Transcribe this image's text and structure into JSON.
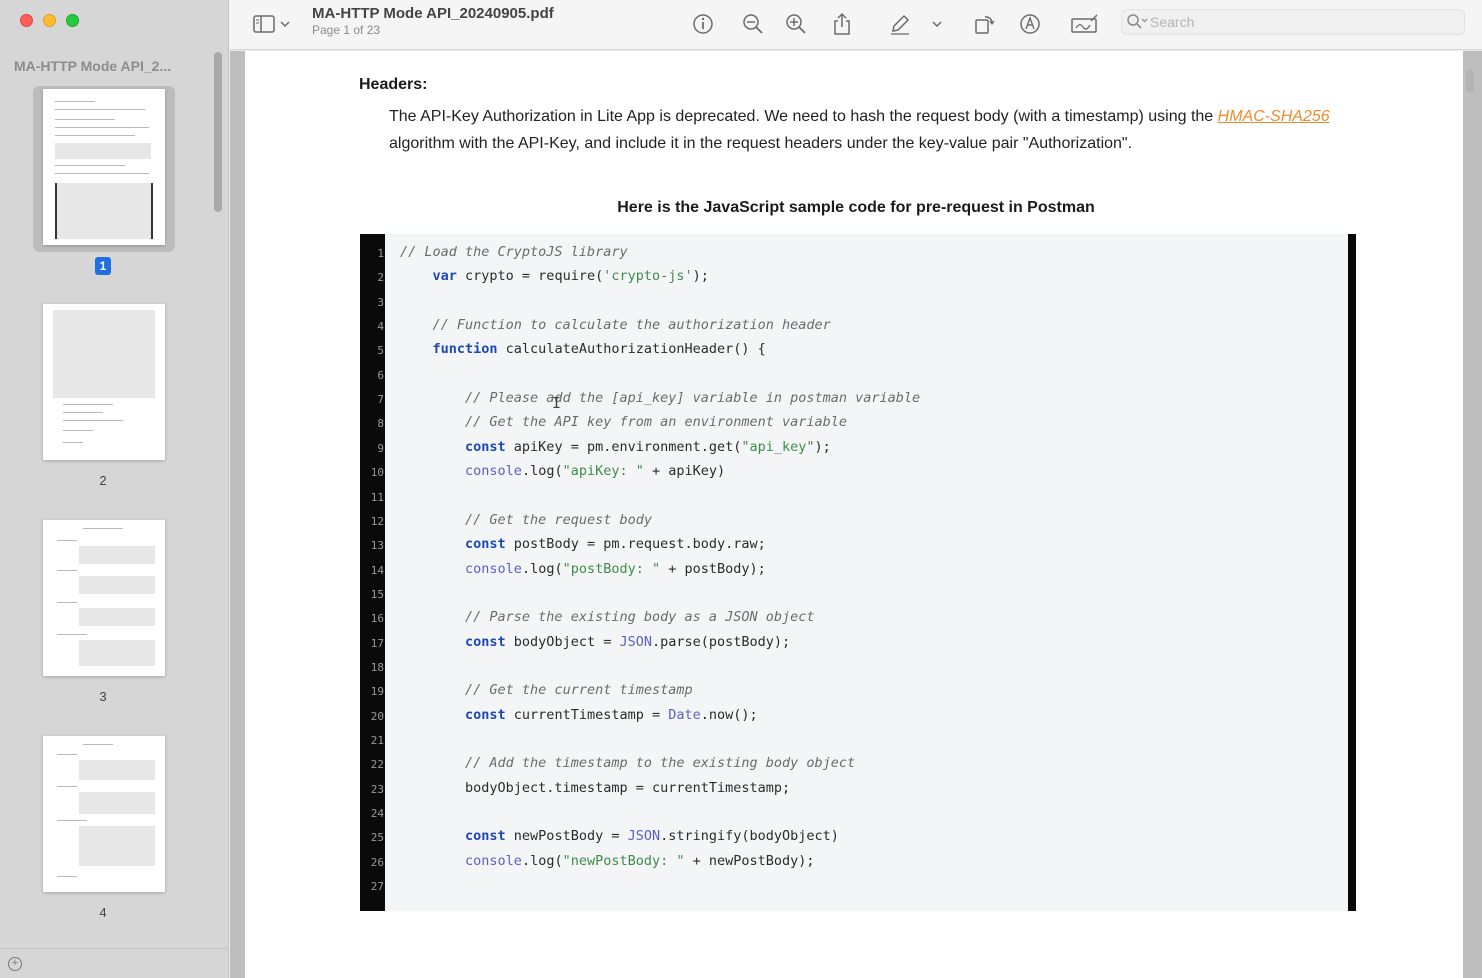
{
  "window": {
    "title": "MA-HTTP Mode API_20240905.pdf",
    "subtitle": "Page 1 of 23"
  },
  "sidebar": {
    "title": "MA-HTTP Mode API_2...",
    "pages": [
      {
        "label": "1",
        "selected": true
      },
      {
        "label": "2",
        "selected": false
      },
      {
        "label": "3",
        "selected": false
      },
      {
        "label": "4",
        "selected": false
      }
    ]
  },
  "toolbar": {
    "icons": [
      "sidebar-toggle-icon",
      "chevron-down-icon",
      "info-icon",
      "zoom-out-icon",
      "zoom-in-icon",
      "share-icon",
      "markup-pen-icon",
      "chevron-down-icon",
      "rotate-icon",
      "annotate-icon",
      "signature-icon",
      "search-icon"
    ],
    "search_placeholder": "Search"
  },
  "document": {
    "heading": "Headers:",
    "para_before_link": "The API-Key Authorization in Lite App is deprecated. We need to hash the request body (with a timestamp) using the ",
    "link_text": "HMAC-SHA256",
    "para_after_link": " algorithm with the API-Key, and include it in the request headers under the key-value pair \"Authorization\".",
    "code_caption": "Here is the JavaScript sample code for pre-request in Postman",
    "link_color": "#f08a2c",
    "code_lines": [
      [
        {
          "t": "// Load the CryptoJS library",
          "c": "cm"
        }
      ],
      [
        {
          "t": "    "
        },
        {
          "t": "var",
          "c": "kw"
        },
        {
          "t": " crypto = require("
        },
        {
          "t": "'crypto-js'",
          "c": "st"
        },
        {
          "t": ");"
        }
      ],
      [],
      [
        {
          "t": "    "
        },
        {
          "t": "// Function to calculate the authorization header",
          "c": "cm"
        }
      ],
      [
        {
          "t": "    "
        },
        {
          "t": "function",
          "c": "kw"
        },
        {
          "t": " calculateAuthorizationHeader() {"
        }
      ],
      [],
      [
        {
          "t": "        "
        },
        {
          "t": "// Please add the [api_key] variable in postman variable",
          "c": "cm"
        }
      ],
      [
        {
          "t": "        "
        },
        {
          "t": "// Get the API key from an environment variable",
          "c": "cm"
        }
      ],
      [
        {
          "t": "        "
        },
        {
          "t": "const",
          "c": "kw"
        },
        {
          "t": " apiKey = pm.environment.get("
        },
        {
          "t": "\"api_key\"",
          "c": "st"
        },
        {
          "t": ");"
        }
      ],
      [
        {
          "t": "        "
        },
        {
          "t": "console",
          "c": "bi"
        },
        {
          "t": ".log("
        },
        {
          "t": "\"apiKey: \"",
          "c": "st"
        },
        {
          "t": " + apiKey)"
        }
      ],
      [],
      [
        {
          "t": "        "
        },
        {
          "t": "// Get the request body",
          "c": "cm"
        }
      ],
      [
        {
          "t": "        "
        },
        {
          "t": "const",
          "c": "kw"
        },
        {
          "t": " postBody = pm.request.body.raw;"
        }
      ],
      [
        {
          "t": "        "
        },
        {
          "t": "console",
          "c": "bi"
        },
        {
          "t": ".log("
        },
        {
          "t": "\"postBody: \"",
          "c": "st"
        },
        {
          "t": " + postBody);"
        }
      ],
      [],
      [
        {
          "t": "        "
        },
        {
          "t": "// Parse the existing body as a JSON object",
          "c": "cm"
        }
      ],
      [
        {
          "t": "        "
        },
        {
          "t": "const",
          "c": "kw"
        },
        {
          "t": " bodyObject = "
        },
        {
          "t": "JSON",
          "c": "bi"
        },
        {
          "t": ".parse(postBody);"
        }
      ],
      [],
      [
        {
          "t": "        "
        },
        {
          "t": "// Get the current timestamp",
          "c": "cm"
        }
      ],
      [
        {
          "t": "        "
        },
        {
          "t": "const",
          "c": "kw"
        },
        {
          "t": " currentTimestamp = "
        },
        {
          "t": "Date",
          "c": "bi"
        },
        {
          "t": ".now();"
        }
      ],
      [],
      [
        {
          "t": "        "
        },
        {
          "t": "// Add the timestamp to the existing body object",
          "c": "cm"
        }
      ],
      [
        {
          "t": "        bodyObject.timestamp = currentTimestamp;"
        }
      ],
      [],
      [
        {
          "t": "        "
        },
        {
          "t": "const",
          "c": "kw"
        },
        {
          "t": " newPostBody = "
        },
        {
          "t": "JSON",
          "c": "bi"
        },
        {
          "t": ".stringify(bodyObject)"
        }
      ],
      [
        {
          "t": "        "
        },
        {
          "t": "console",
          "c": "bi"
        },
        {
          "t": ".log("
        },
        {
          "t": "\"newPostBody: \"",
          "c": "st"
        },
        {
          "t": " + newPostBody);"
        }
      ],
      []
    ]
  }
}
